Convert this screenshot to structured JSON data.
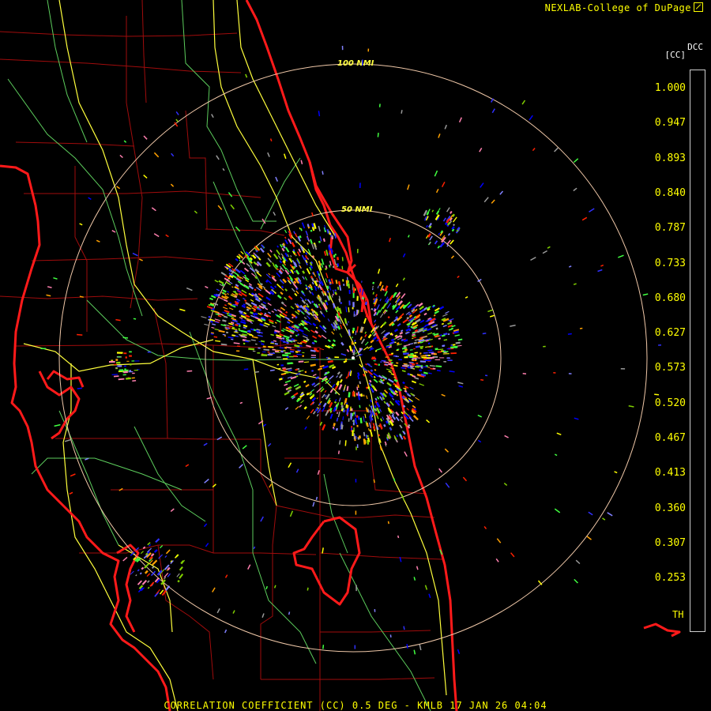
{
  "header": {
    "credit": "NEXLAB-College of DuPage",
    "logo_icon": "nexlab-logo-icon"
  },
  "legend": {
    "product_code": "DCC",
    "unit": "[CC]",
    "ticks": [
      "1.000",
      "0.947",
      "0.893",
      "0.840",
      "0.787",
      "0.733",
      "0.680",
      "0.627",
      "0.573",
      "0.520",
      "0.467",
      "0.413",
      "0.360",
      "0.307",
      "0.253"
    ],
    "th_label": "TH",
    "scale_stops": [
      {
        "color": "#000000",
        "from": 0.0,
        "to": 0.015
      },
      {
        "color": "#9a9a9a",
        "from": 0.015,
        "to": 0.285
      },
      {
        "color": "#7f7f9a",
        "from": 0.285,
        "to": 0.305
      },
      {
        "color": "#1a1a8c",
        "from": 0.305,
        "to": 0.34
      },
      {
        "color": "#0000ff",
        "from": 0.34,
        "to": 0.62
      },
      {
        "color": "#4040ff",
        "from": 0.62,
        "to": 0.65
      },
      {
        "color": "#8080ff",
        "from": 0.65,
        "to": 0.69
      },
      {
        "color": "#7fa0d0",
        "from": 0.69,
        "to": 0.705
      },
      {
        "color": "#40ff40",
        "from": 0.705,
        "to": 0.73
      },
      {
        "color": "#80ff80",
        "from": 0.73,
        "to": 0.75
      },
      {
        "color": "#40c000",
        "from": 0.75,
        "to": 0.77
      },
      {
        "color": "#80d000",
        "from": 0.77,
        "to": 0.8
      },
      {
        "color": "#c8e000",
        "from": 0.8,
        "to": 0.82
      },
      {
        "color": "#ffff00",
        "from": 0.82,
        "to": 0.85
      },
      {
        "color": "#ffd000",
        "from": 0.85,
        "to": 0.87
      },
      {
        "color": "#ffa000",
        "from": 0.87,
        "to": 0.89
      },
      {
        "color": "#ff6000",
        "from": 0.89,
        "to": 0.91
      },
      {
        "color": "#ff2000",
        "from": 0.91,
        "to": 0.93
      },
      {
        "color": "#c00000",
        "from": 0.93,
        "to": 0.95
      },
      {
        "color": "#c02050",
        "from": 0.95,
        "to": 0.965
      },
      {
        "color": "#ff80b0",
        "from": 0.965,
        "to": 0.985
      },
      {
        "color": "#ffb0d0",
        "from": 0.985,
        "to": 1.0
      }
    ]
  },
  "range_rings": {
    "inner_label": "50 NMI",
    "outer_label": "100 NMI",
    "color": "#f0c8a8"
  },
  "map_colors": {
    "coastline": "#ff1a1a",
    "counties": "#b01010",
    "highways": "#ffff40",
    "roads": "#60d060"
  },
  "footer": {
    "title": "CORRELATION COEFFICIENT (CC) 0.5 DEG - KMLB 17 JAN 26 04:04"
  }
}
